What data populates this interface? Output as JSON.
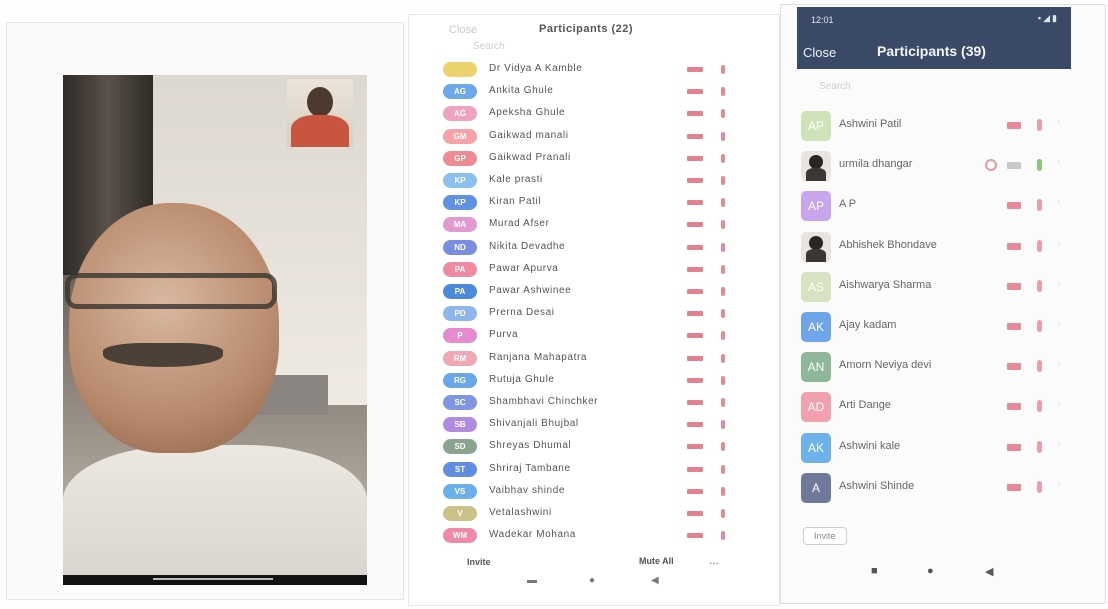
{
  "panel2": {
    "close_label": "Close",
    "title": "Participants (22)",
    "search_placeholder": "Search",
    "participants": [
      {
        "initials": "",
        "name": "Dr Vidya A Kamble",
        "color": "#ead36a"
      },
      {
        "initials": "AG",
        "name": "Ankita Ghule",
        "color": "#6fa8e8"
      },
      {
        "initials": "AG",
        "name": "Apeksha Ghule",
        "color": "#f0a3c0"
      },
      {
        "initials": "GM",
        "name": "Gaikwad manali",
        "color": "#f5a2a8"
      },
      {
        "initials": "GP",
        "name": "Gaikwad Pranali",
        "color": "#ee8a92"
      },
      {
        "initials": "KP",
        "name": "Kale prasti",
        "color": "#8bc0ee"
      },
      {
        "initials": "KP",
        "name": "Kiran Patil",
        "color": "#5f92e0"
      },
      {
        "initials": "MA",
        "name": "Murad Afser",
        "color": "#e39ad0"
      },
      {
        "initials": "ND",
        "name": "Nikita Devadhe",
        "color": "#7a8ee0"
      },
      {
        "initials": "PA",
        "name": "Pawar Apurva",
        "color": "#f08aa0"
      },
      {
        "initials": "PA",
        "name": "Pawar Ashwinee",
        "color": "#4a8ad8"
      },
      {
        "initials": "PD",
        "name": "Prerna Desai",
        "color": "#8fb6ea"
      },
      {
        "initials": "P",
        "name": "Purva",
        "color": "#e68ad0"
      },
      {
        "initials": "RM",
        "name": "Ranjana Mahapatra",
        "color": "#f0a8b4"
      },
      {
        "initials": "RG",
        "name": "Rutuja Ghule",
        "color": "#6aa6e8"
      },
      {
        "initials": "SC",
        "name": "Shambhavi Chinchker",
        "color": "#7f96e2"
      },
      {
        "initials": "SB",
        "name": "Shivanjali Bhujbal",
        "color": "#b08ce0"
      },
      {
        "initials": "SD",
        "name": "Shreyas Dhumal",
        "color": "#8aa490"
      },
      {
        "initials": "ST",
        "name": "Shriraj Tambane",
        "color": "#5f8ee0"
      },
      {
        "initials": "VS",
        "name": "Vaibhav shinde",
        "color": "#6ab0ea"
      },
      {
        "initials": "V",
        "name": "Vetalashwini",
        "color": "#c9c28a"
      },
      {
        "initials": "WM",
        "name": "Wadekar Mohana",
        "color": "#ee8aa8"
      }
    ],
    "invite_label": "Invite",
    "mute_all_label": "Mute All",
    "more_label": "..."
  },
  "panel3": {
    "status_time": "12:01",
    "close_label": "Close",
    "title": "Participants (39)",
    "search_placeholder": "Search",
    "participants": [
      {
        "initials": "AP",
        "name": "Ashwini Patil",
        "color": "#cfe3b8",
        "photo": false
      },
      {
        "initials": "",
        "name": "urmila dhangar",
        "color": "#e9e4df",
        "photo": true
      },
      {
        "initials": "AP",
        "name": "A P",
        "color": "#c8a6ee",
        "photo": false
      },
      {
        "initials": "",
        "name": "Abhishek Bhondave",
        "color": "#e9e4df",
        "photo": true
      },
      {
        "initials": "AS",
        "name": "Aishwarya Sharma",
        "color": "#d6e2c0",
        "photo": false
      },
      {
        "initials": "AK",
        "name": "Ajay kadam",
        "color": "#6ea4ea",
        "photo": false
      },
      {
        "initials": "AN",
        "name": "Amorn Neviya devi",
        "color": "#8fb79a",
        "photo": false
      },
      {
        "initials": "AD",
        "name": "Arti Dange",
        "color": "#f1a0ae",
        "photo": false
      },
      {
        "initials": "AK",
        "name": "Ashwini kale",
        "color": "#6eb2ec",
        "photo": false
      },
      {
        "initials": "A",
        "name": "Ashwini Shinde",
        "color": "#6f7a9a",
        "photo": false
      }
    ],
    "invite_label": "Invite"
  }
}
